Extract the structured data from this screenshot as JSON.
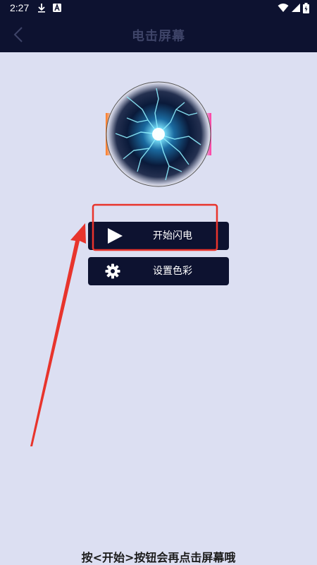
{
  "status_bar": {
    "time": "2:27",
    "icons": [
      "download-icon",
      "notification-a-icon",
      "wifi-icon",
      "signal-icon",
      "battery-icon"
    ]
  },
  "app_bar": {
    "title": "电击屏幕",
    "back_icon": "chevron-left-icon"
  },
  "orb": {
    "description_icon": "lightning-orb-icon"
  },
  "buttons": {
    "start_label": "开始闪电",
    "start_icon": "play-icon",
    "color_label": "设置色彩",
    "color_icon": "gear-icon"
  },
  "annotation": {
    "highlight_color": "#e8342c",
    "arrow_color": "#e8342c"
  },
  "hint": {
    "text": "按<开始>按钮会再点击屏幕哦"
  },
  "colors": {
    "dark_navy": "#0d1230",
    "background": "#dcdff2",
    "title_text": "#3e4468"
  }
}
